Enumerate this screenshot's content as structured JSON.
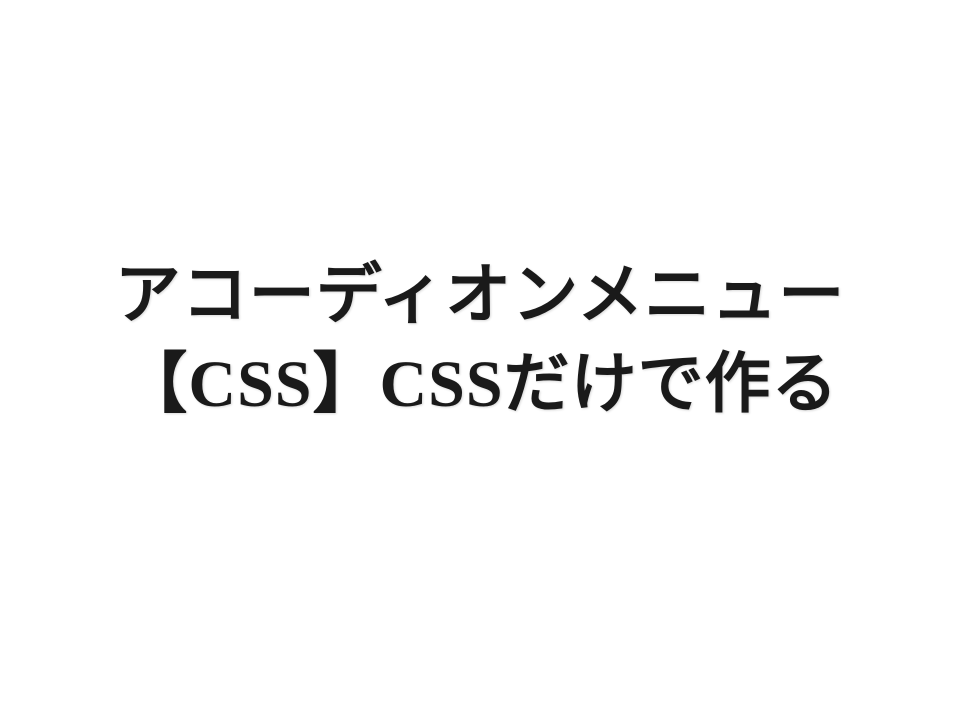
{
  "title": {
    "line1": "アコーディオンメニュー",
    "line2": "【CSS】CSSだけで作る"
  }
}
